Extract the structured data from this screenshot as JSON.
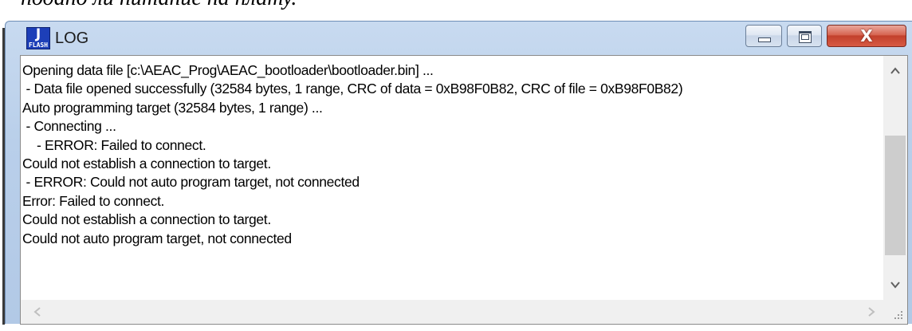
{
  "document": {
    "caption": "подано ли питание на плату."
  },
  "window": {
    "title": "LOG",
    "icon_label": "J",
    "icon_sublabel": "FLASH",
    "icons": {
      "app": "jflash-app-icon",
      "minimize": "minimize-icon",
      "maximize": "maximize-icon",
      "close": "close-icon",
      "scroll_up": "chevron-up-icon",
      "scroll_down": "chevron-down-icon",
      "scroll_left": "chevron-left-icon",
      "scroll_right": "chevron-right-icon",
      "size_grip": "size-grip-icon"
    },
    "close_glyph": "X",
    "accent_color": "#c2402c",
    "frame_color": "#b9cfea"
  },
  "log": {
    "lines": [
      "Opening data file [c:\\AEAC_Prog\\AEAC_bootloader\\bootloader.bin] ...",
      " - Data file opened successfully (32584 bytes, 1 range, CRC of data = 0xB98F0B82, CRC of file = 0xB98F0B82)",
      "Auto programming target (32584 bytes, 1 range) ...",
      " - Connecting ...",
      "    - ERROR: Failed to connect.",
      "Could not establish a connection to target.",
      " - ERROR: Could not auto program target, not connected",
      "Error: Failed to connect.",
      "Could not establish a connection to target.",
      "Could not auto program target, not connected"
    ]
  },
  "scrollbars": {
    "up_glyph": "︿",
    "down_glyph": "﹀",
    "left_glyph": "<",
    "right_glyph": ">"
  }
}
